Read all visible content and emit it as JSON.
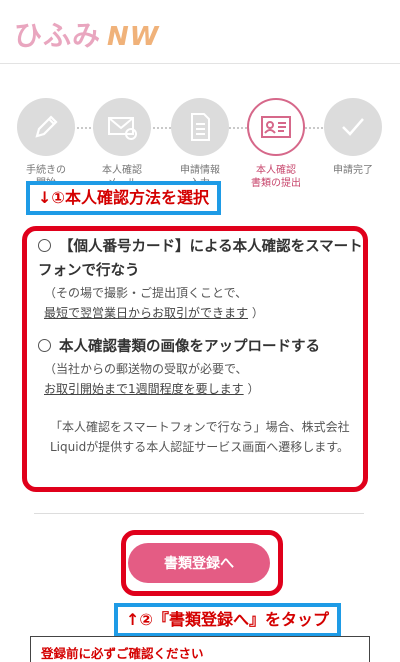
{
  "logo": {
    "main": "ひふみ",
    "sub": "NW"
  },
  "steps": [
    {
      "label": "手続きの\n開始",
      "icon": "pencil-icon",
      "active": false
    },
    {
      "label": "本人確認\nメール",
      "icon": "mail-icon",
      "active": false
    },
    {
      "label": "申請情報\n入力",
      "icon": "document-icon",
      "active": false
    },
    {
      "label": "本人確認\n書類の提出",
      "icon": "id-card-icon",
      "active": true
    },
    {
      "label": "申請完了",
      "icon": "checkmark-icon",
      "active": false
    }
  ],
  "callout1": "↓①本人確認方法を選択",
  "options": [
    {
      "title": "【個人番号カード】による本人確認をスマートフォンで行なう",
      "note1": "（その場で撮影・ご提出頂くことで、",
      "note2_link": "最短で翌営業日からお取引ができます",
      "note2_end": "）"
    },
    {
      "title": "本人確認書類の画像をアップロードする",
      "note1": "（当社からの郵送物の受取が必要で、",
      "note2_link": "お取引開始まで1週間程度を要します",
      "note2_end": "）"
    }
  ],
  "notice": "「本人確認をスマートフォンで行なう」場合、株式会社Liquidが提供する本人認証サービス画面へ遷移します。",
  "button": "書類登録へ",
  "callout2": "↑②『書類登録へ』をタップ",
  "confirm_heading": "登録前に必ずご確認ください",
  "colors": {
    "accent": "#e45c84",
    "annotation_red": "#e0001b",
    "annotation_blue": "#1e9be6"
  }
}
